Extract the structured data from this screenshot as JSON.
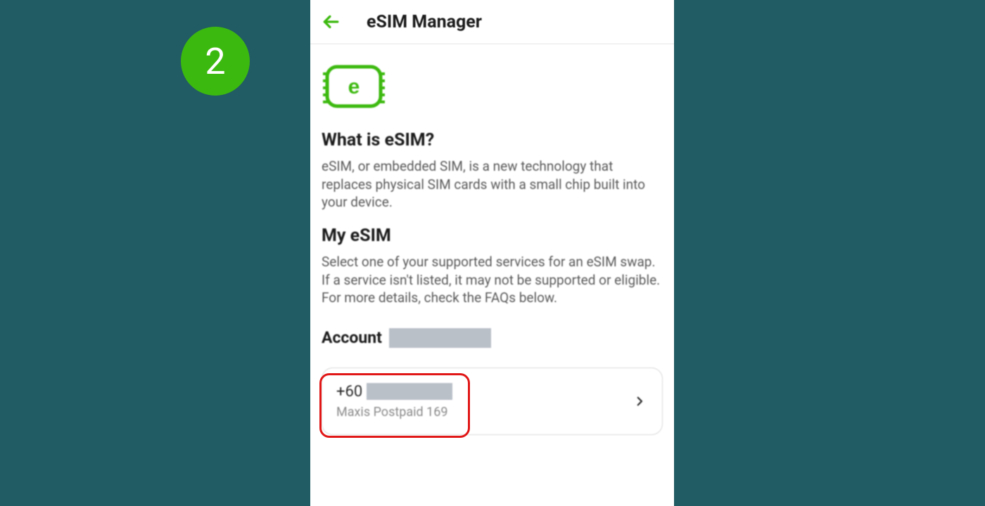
{
  "step_badge": "2",
  "colors": {
    "accent": "#3cb90f",
    "background": "#215b63",
    "highlight": "#e11717"
  },
  "header": {
    "title": "eSIM Manager"
  },
  "icons": {
    "esim_letter": "e"
  },
  "sections": {
    "what_is_heading": "What is eSIM?",
    "what_is_body": "eSIM, or embedded SIM, is a new technology that replaces physical SIM cards with a small chip built into your device.",
    "my_esim_heading": "My eSIM",
    "my_esim_body": "Select one of your supported services for an eSIM swap. If a service isn't listed, it may not be supported or eligible. For more details, check the FAQs below."
  },
  "account": {
    "label": "Account"
  },
  "service": {
    "phone_prefix": "+60",
    "plan_label": "Maxis Postpaid 169"
  }
}
